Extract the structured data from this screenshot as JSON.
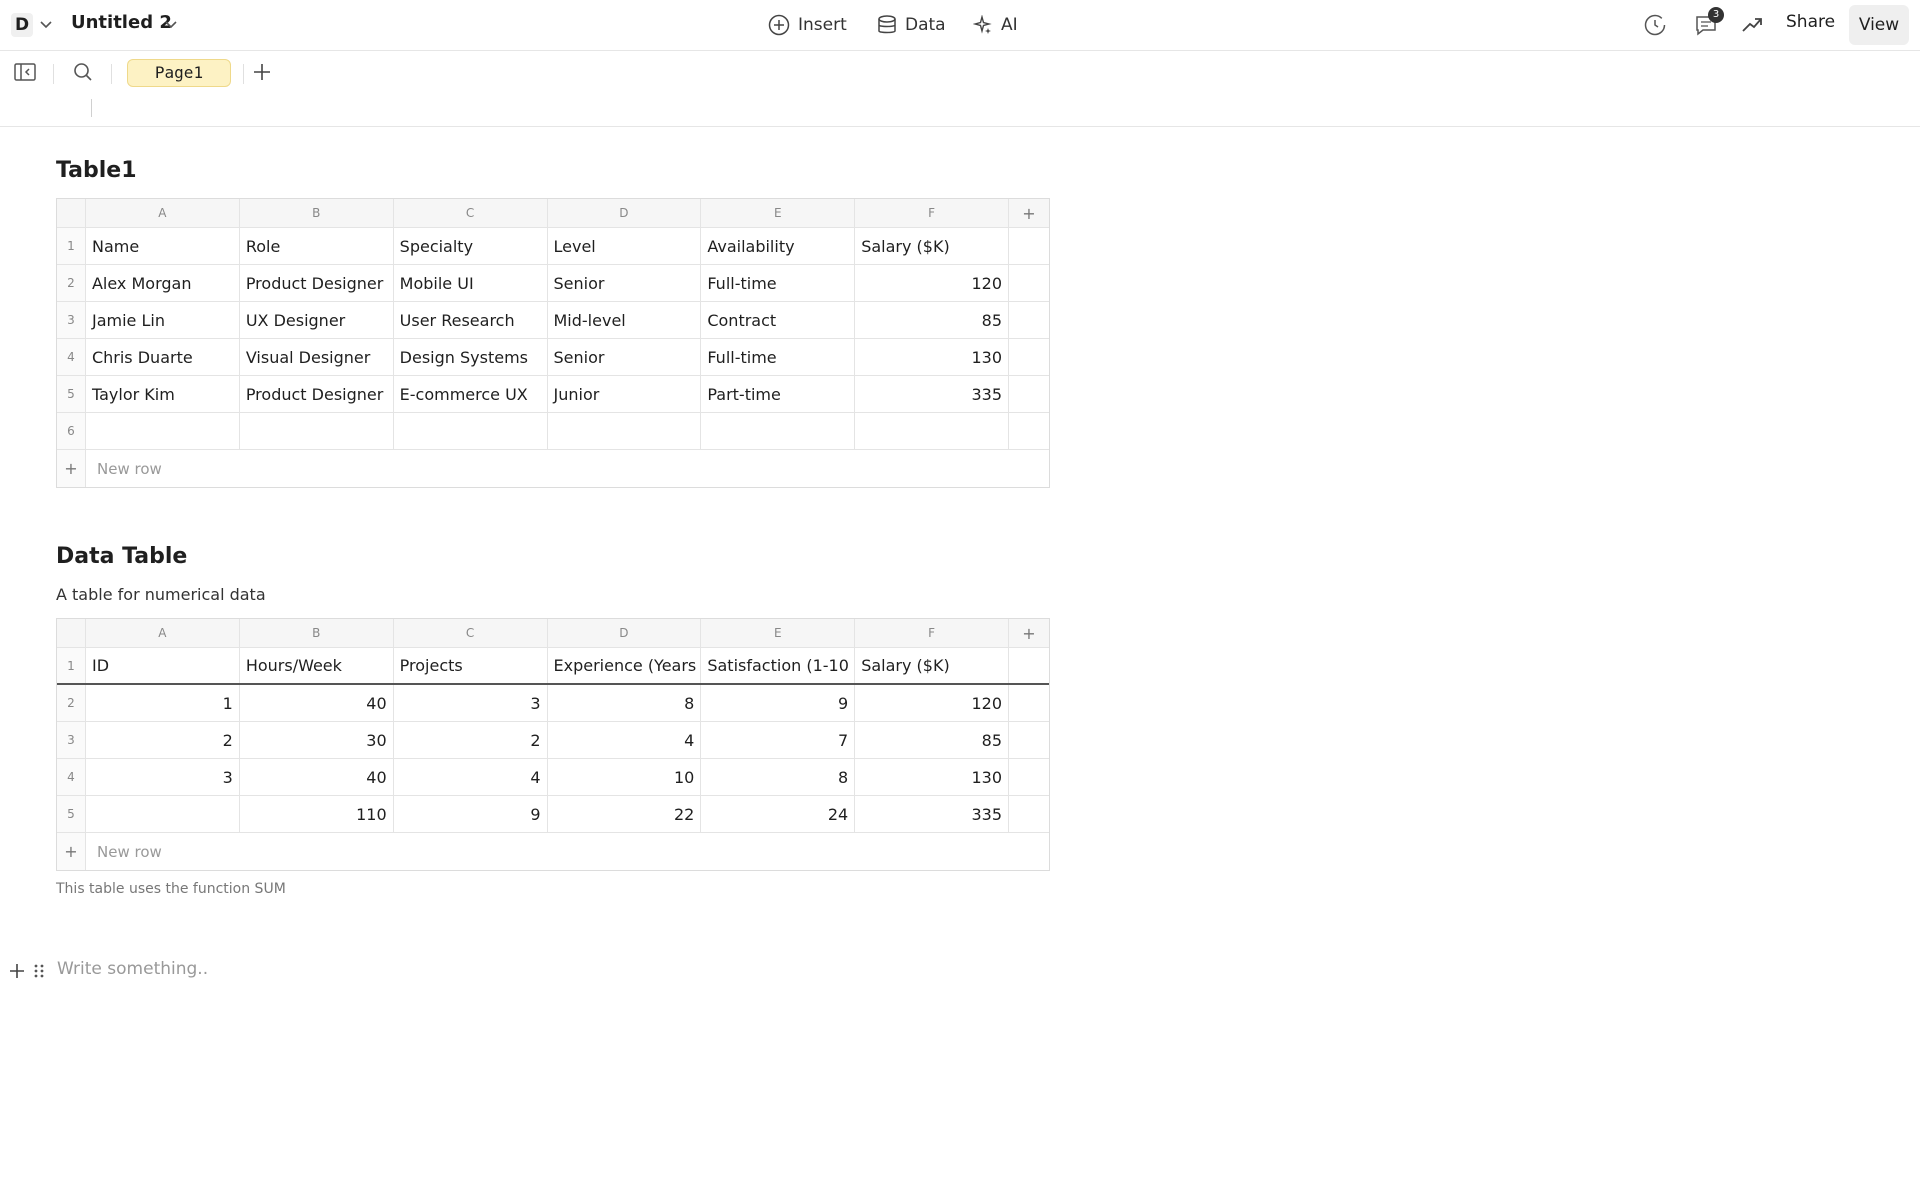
{
  "topbar": {
    "workspace_initial": "D",
    "doc_title": "Untitled 2",
    "insert_label": "Insert",
    "data_label": "Data",
    "ai_label": "AI",
    "notification_count": "3",
    "share_label": "Share",
    "view_label": "View"
  },
  "pagebar": {
    "page_tab": "Page1"
  },
  "table1": {
    "title": "Table1",
    "columns": [
      "A",
      "B",
      "C",
      "D",
      "E",
      "F"
    ],
    "rows": [
      [
        "1",
        "Name",
        "Role",
        "Specialty",
        "Level",
        "Availability",
        "Salary ($K)"
      ],
      [
        "2",
        "Alex Morgan",
        "Product Designer",
        "Mobile UI",
        "Senior",
        "Full-time",
        "120"
      ],
      [
        "3",
        "Jamie Lin",
        "UX Designer",
        "User Research",
        "Mid-level",
        "Contract",
        "85"
      ],
      [
        "4",
        "Chris Duarte",
        "Visual Designer",
        "Design Systems",
        "Senior",
        "Full-time",
        "130"
      ],
      [
        "5",
        "Taylor Kim",
        "Product Designer",
        "E-commerce UX",
        "Junior",
        "Part-time",
        "335"
      ],
      [
        "6",
        "",
        "",
        "",
        "",
        "",
        ""
      ]
    ],
    "new_row_label": "New row"
  },
  "table2": {
    "title": "Data Table",
    "description": "A table for numerical data",
    "columns": [
      "A",
      "B",
      "C",
      "D",
      "E",
      "F"
    ],
    "rows": [
      [
        "1",
        "ID",
        "Hours/Week",
        "Projects",
        "Experience (Years",
        "Satisfaction (1-10",
        "Salary ($K)"
      ],
      [
        "2",
        "1",
        "40",
        "3",
        "8",
        "9",
        "120"
      ],
      [
        "3",
        "2",
        "30",
        "2",
        "4",
        "7",
        "85"
      ],
      [
        "4",
        "3",
        "40",
        "4",
        "10",
        "8",
        "130"
      ],
      [
        "5",
        "",
        "110",
        "9",
        "22",
        "24",
        "335"
      ]
    ],
    "new_row_label": "New row",
    "caption": "This table uses the function SUM"
  },
  "editor": {
    "placeholder": "Write something.."
  },
  "icons": {
    "add": "plus-icon",
    "ws_menu": "chevron-down-icon",
    "insert": "plus-circle-icon",
    "data": "database-icon",
    "ai": "sparkle-icon",
    "history": "history-icon",
    "comments": "comment-icon",
    "trend": "trend-arrow-icon",
    "sidebar": "sidebar-toggle-icon",
    "search": "search-icon",
    "drag": "drag-handle-icon"
  },
  "colors": {
    "page_tab_bg": "#fdf2c4",
    "accent_text": "#1f1f1f"
  }
}
